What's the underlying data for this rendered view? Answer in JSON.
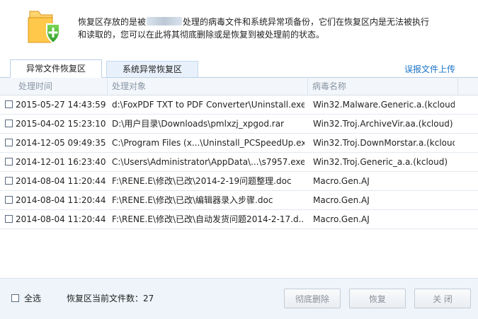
{
  "header": {
    "description_part1": "恢复区存放的是被",
    "description_part2": "处理的病毒文件和系统异常项备份，它们在恢复区内是无法被执行",
    "description_line2": "和读取的，您可以在此将其彻底删除或是恢复到被处理前的状态。"
  },
  "tabs": {
    "active": "异常文件恢复区",
    "inactive": "系统异常恢复区"
  },
  "report_link": "误报文件上传",
  "table": {
    "columns": [
      "处理时间",
      "处理对象",
      "病毒名称"
    ],
    "rows": [
      {
        "time": "2015-05-27 14:43:59",
        "object": "d:\\FoxPDF TXT to PDF Converter\\Uninstall.exe",
        "virus": "Win32.Malware.Generic.a.(kcloud)"
      },
      {
        "time": "2015-04-02 15:23:10",
        "object": "D:\\用户目录\\Downloads\\pmlxzj_xpgod.rar",
        "virus": "Win32.Troj.ArchiveVir.aa.(kcloud)"
      },
      {
        "time": "2014-12-05 09:49:35",
        "object": "C:\\Program Files (x...\\Uninstall_PCSpeedUp.exe",
        "virus": "Win32.Troj.DownMorstar.a.(kcloud)"
      },
      {
        "time": "2014-12-01 16:23:40",
        "object": "C:\\Users\\Administrator\\AppData\\...\\s7957.exe",
        "virus": "Win32.Troj.Generic_a.a.(kcloud)"
      },
      {
        "time": "2014-08-04 11:20:44",
        "object": "F:\\RENE.E\\修改\\已改\\2014-2-19问题整理.doc",
        "virus": "Macro.Gen.AJ"
      },
      {
        "time": "2014-08-04 11:20:44",
        "object": "F:\\RENE.E\\修改\\已改\\编辑器录入步骤.doc",
        "virus": "Macro.Gen.AJ"
      },
      {
        "time": "2014-08-04 11:20:44",
        "object": "F:\\RENE.E\\修改\\已改\\自动发货问题2014-2-17.d...",
        "virus": "Macro.Gen.AJ"
      }
    ]
  },
  "footer": {
    "select_all": "全选",
    "count_text": "恢复区当前文件数：27",
    "delete_button": "彻底删除",
    "restore_button": "恢复",
    "close_button": "关 闭"
  },
  "icons": {
    "logo": "folder-shield-icon"
  }
}
